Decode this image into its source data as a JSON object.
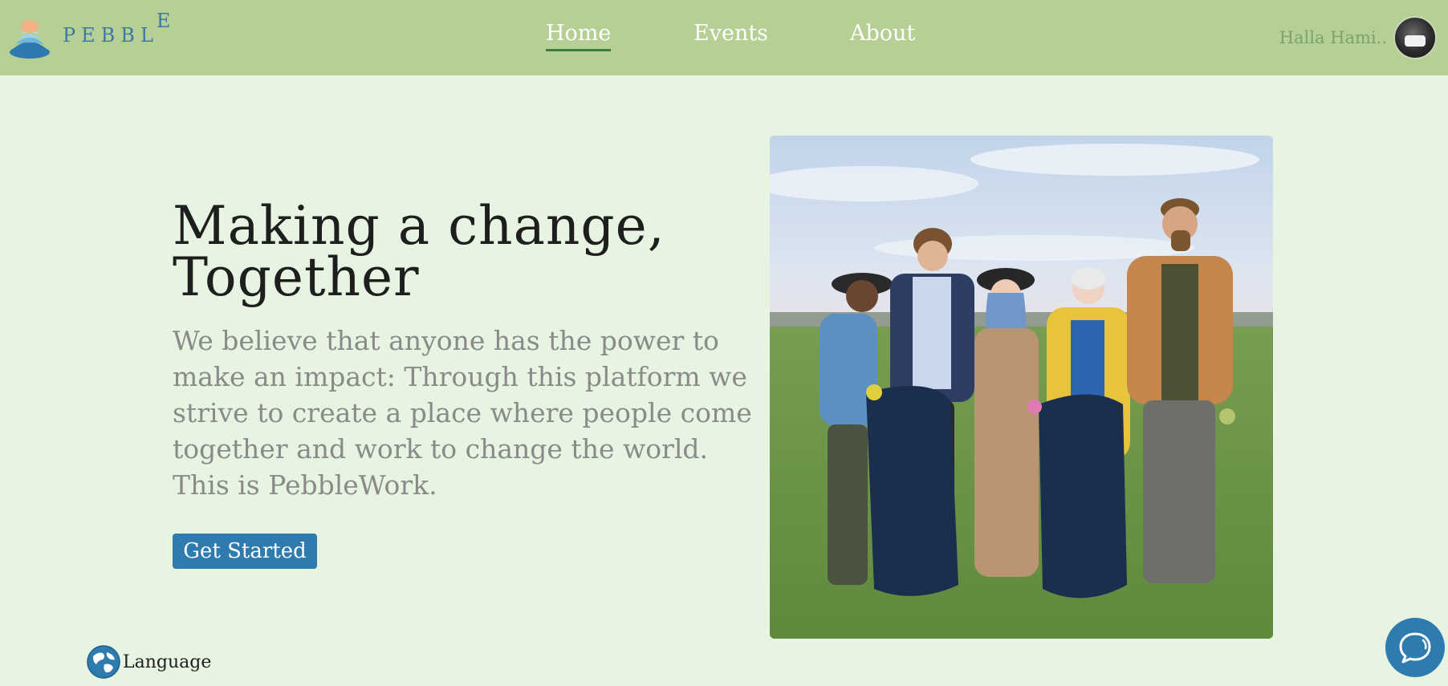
{
  "app": {
    "logo_text": "PEBBL",
    "logo_last_letter": "E"
  },
  "nav": {
    "items": [
      {
        "label": "Home",
        "active": true
      },
      {
        "label": "Events",
        "active": false
      },
      {
        "label": "About",
        "active": false
      }
    ]
  },
  "user": {
    "name": "Halla Hami.."
  },
  "hero": {
    "title_line1": "Making a change,",
    "title_line2": "Together",
    "description": "We believe that anyone has the power to make an impact: Through this platform we strive to create a place where people come together and work to change the world. This is PebbleWork.",
    "cta_label": "Get Started"
  },
  "footer": {
    "language_label": "Language"
  },
  "icons": {
    "logo": "pebble-stack-icon",
    "language": "globe-icon",
    "chat": "chat-bubble-icon",
    "avatar": "user-avatar"
  },
  "colors": {
    "header_bg": "#b5cf95",
    "page_bg": "#e6f4e1",
    "accent": "#2e7bb0",
    "logo_text": "#3a7aa8",
    "user_name": "#7ba36b"
  }
}
